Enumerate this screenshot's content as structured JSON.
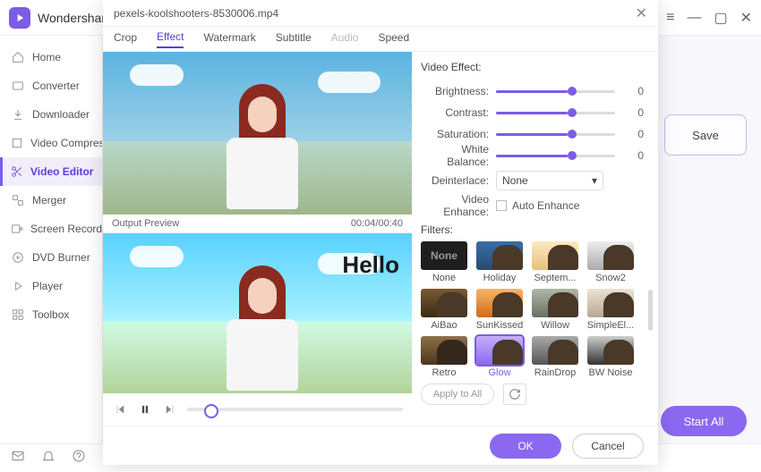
{
  "brand": "Wondershare",
  "sidebar": {
    "items": [
      {
        "label": "Home"
      },
      {
        "label": "Converter"
      },
      {
        "label": "Downloader"
      },
      {
        "label": "Video Compres"
      },
      {
        "label": "Video Editor"
      },
      {
        "label": "Merger"
      },
      {
        "label": "Screen Recorde"
      },
      {
        "label": "DVD Burner"
      },
      {
        "label": "Player"
      },
      {
        "label": "Toolbox"
      }
    ]
  },
  "save_label": "Save",
  "start_all_label": "Start All",
  "modal": {
    "filename": "pexels-koolshooters-8530006.mp4",
    "tabs": [
      "Crop",
      "Effect",
      "Watermark",
      "Subtitle",
      "Audio",
      "Speed"
    ],
    "active_tab": "Effect",
    "disabled_tab": "Audio",
    "output_preview_label": "Output Preview",
    "timecode": "00:04/00:40",
    "hello_text": "Hello",
    "video_effect": {
      "title": "Video Effect:",
      "sliders": [
        {
          "label": "Brightness:",
          "value": 0
        },
        {
          "label": "Contrast:",
          "value": 0
        },
        {
          "label": "Saturation:",
          "value": 0
        },
        {
          "label": "White Balance:",
          "value": 0
        }
      ],
      "deinterlace_label": "Deinterlace:",
      "deinterlace_value": "None",
      "enhance_label": "Video Enhance:",
      "auto_enhance": "Auto Enhance"
    },
    "filters": {
      "title": "Filters:",
      "none_text": "None",
      "items": [
        {
          "name": "None",
          "cls": "f-none"
        },
        {
          "name": "Holiday",
          "cls": "f-holiday"
        },
        {
          "name": "Septem...",
          "cls": "f-sept"
        },
        {
          "name": "Snow2",
          "cls": "f-snow"
        },
        {
          "name": "AiBao",
          "cls": "f-aibao"
        },
        {
          "name": "SunKissed",
          "cls": "f-sun"
        },
        {
          "name": "Willow",
          "cls": "f-willow"
        },
        {
          "name": "SimpleEl...",
          "cls": "f-simple"
        },
        {
          "name": "Retro",
          "cls": "f-retro"
        },
        {
          "name": "Glow",
          "cls": "f-glow"
        },
        {
          "name": "RainDrop",
          "cls": "f-rain"
        },
        {
          "name": "BW Noise",
          "cls": "f-bw"
        }
      ],
      "selected": "Glow",
      "apply_all": "Apply to All"
    },
    "ok": "OK",
    "cancel": "Cancel"
  }
}
